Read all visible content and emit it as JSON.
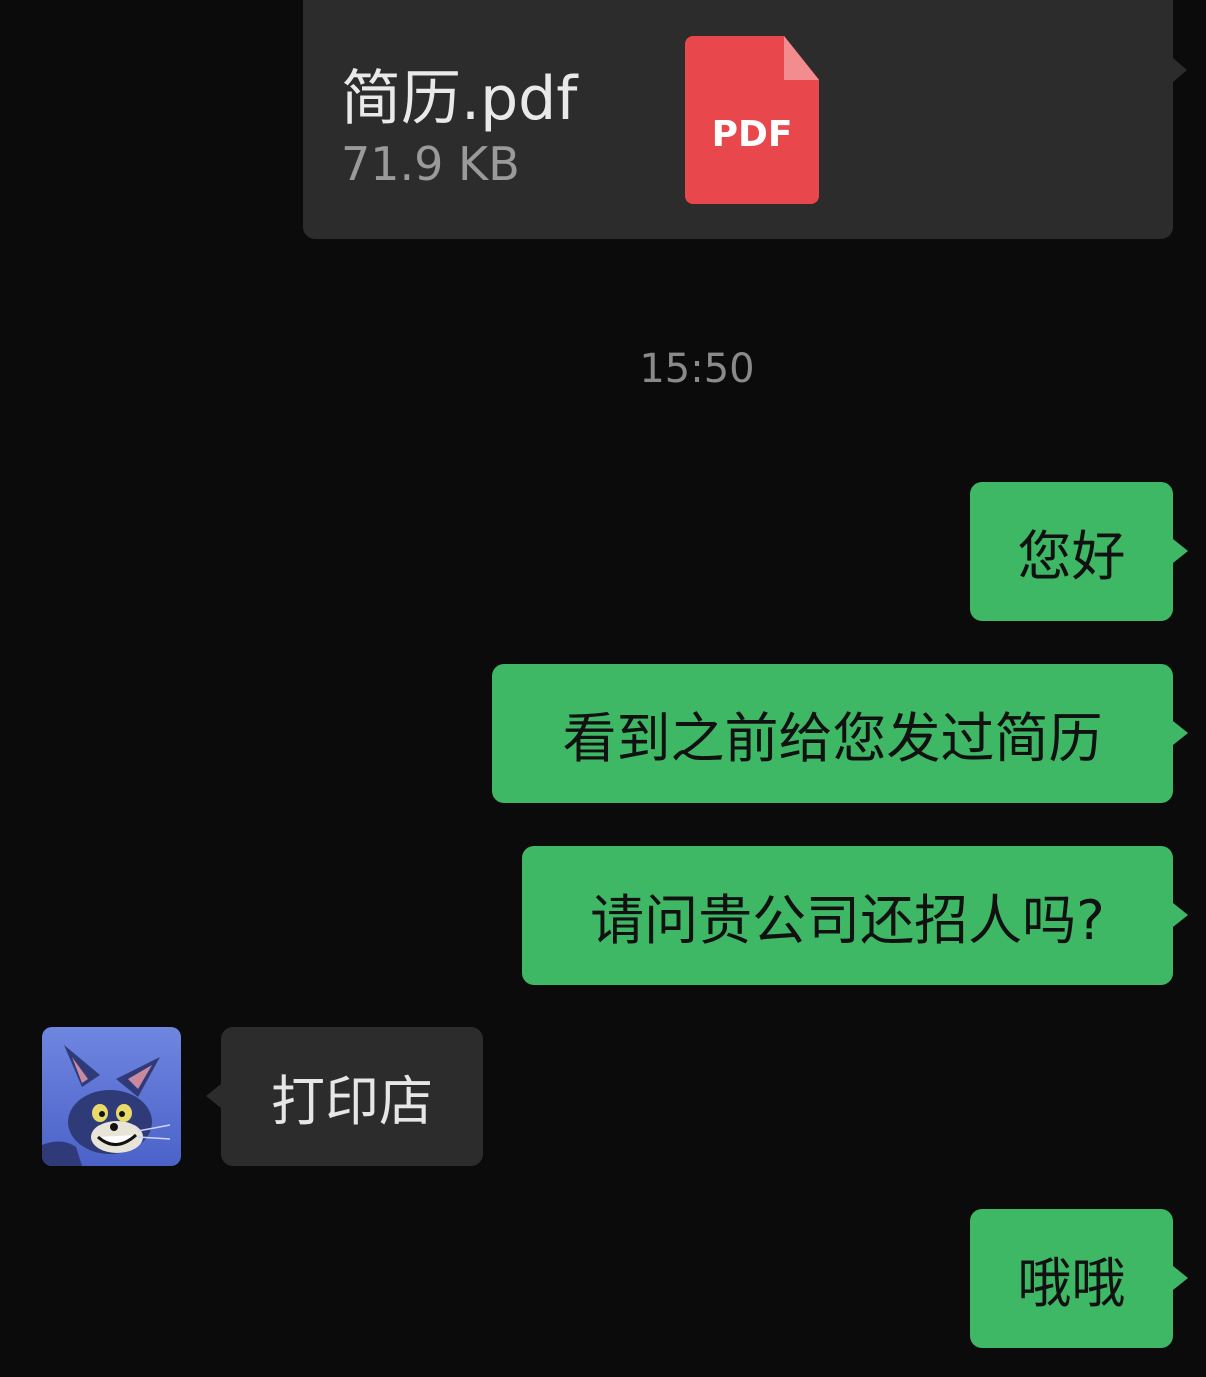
{
  "file_message": {
    "file_name": "简历.pdf",
    "file_size": "71.9 KB",
    "icon_label": "PDF",
    "icon": "pdf-file-icon"
  },
  "timestamp": "15:50",
  "messages": [
    {
      "sender": "me",
      "text": "您好"
    },
    {
      "sender": "me",
      "text": "看到之前给您发过简历"
    },
    {
      "sender": "me",
      "text": "请问贵公司还招人吗?"
    },
    {
      "sender": "contact",
      "text": "打印店",
      "avatar": "cartoon-cat-avatar"
    },
    {
      "sender": "me",
      "text": "哦哦"
    }
  ],
  "colors": {
    "background": "#0b0b0b",
    "outgoing_bubble": "#3fb866",
    "incoming_bubble": "#2c2c2c",
    "pdf_icon": "#e8474b"
  }
}
